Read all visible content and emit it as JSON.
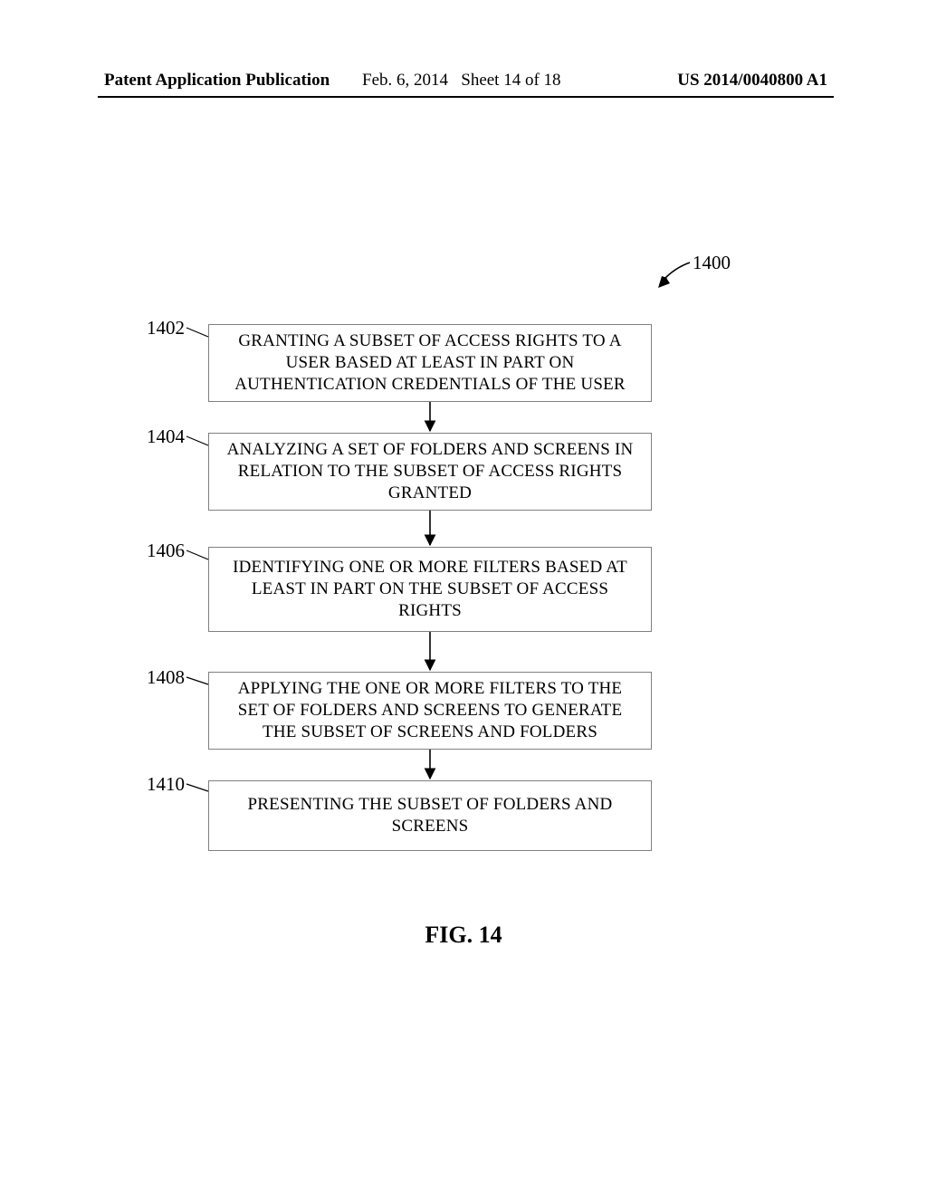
{
  "header": {
    "left": "Patent Application Publication",
    "date": "Feb. 6, 2014",
    "sheet": "Sheet 14 of 18",
    "pubno": "US 2014/0040800 A1"
  },
  "diagram": {
    "overall_ref": "1400",
    "steps": [
      {
        "ref": "1402",
        "text": "GRANTING A SUBSET OF ACCESS RIGHTS TO A USER BASED AT LEAST IN PART ON AUTHENTICATION CREDENTIALS OF THE USER"
      },
      {
        "ref": "1404",
        "text": "ANALYZING A SET OF FOLDERS AND SCREENS IN RELATION TO THE SUBSET OF ACCESS RIGHTS GRANTED"
      },
      {
        "ref": "1406",
        "text": "IDENTIFYING ONE OR MORE FILTERS BASED AT LEAST IN PART ON THE SUBSET OF ACCESS RIGHTS"
      },
      {
        "ref": "1408",
        "text": "APPLYING THE ONE OR MORE FILTERS TO THE SET OF FOLDERS AND SCREENS TO GENERATE THE SUBSET OF SCREENS AND FOLDERS"
      },
      {
        "ref": "1410",
        "text": "PRESENTING THE SUBSET OF FOLDERS AND SCREENS"
      }
    ],
    "caption": "FIG. 14"
  }
}
